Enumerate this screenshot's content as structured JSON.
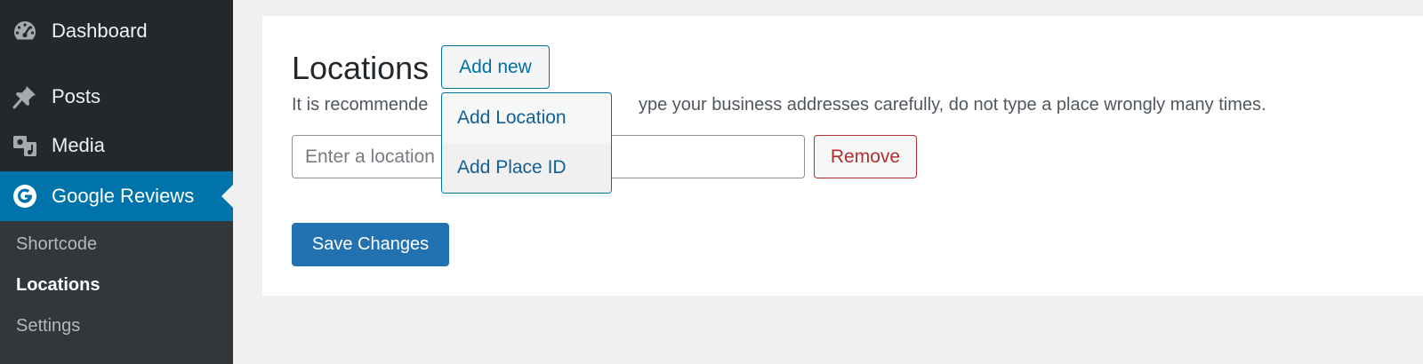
{
  "sidebar": {
    "items": [
      {
        "label": "Dashboard",
        "icon": "dashboard-icon"
      },
      {
        "label": "Posts",
        "icon": "pushpin-icon"
      },
      {
        "label": "Media",
        "icon": "media-icon"
      },
      {
        "label": "Google Reviews",
        "icon": "google-icon"
      }
    ],
    "submenu": [
      {
        "label": "Shortcode"
      },
      {
        "label": "Locations"
      },
      {
        "label": "Settings"
      }
    ]
  },
  "main": {
    "title": "Locations",
    "add_new_label": "Add new",
    "description_start": "It is recommende",
    "description_end": "ype your business addresses carefully, do not type a place wrongly many times.",
    "location_input_placeholder": "Enter a location",
    "remove_label": "Remove",
    "save_label": "Save Changes"
  },
  "dropdown": {
    "items": [
      {
        "label": "Add Location"
      },
      {
        "label": "Add Place ID"
      }
    ]
  },
  "colors": {
    "sidebar_bg": "#23282d",
    "submenu_bg": "#32373c",
    "accent": "#0073aa",
    "danger": "#b32d2e"
  }
}
